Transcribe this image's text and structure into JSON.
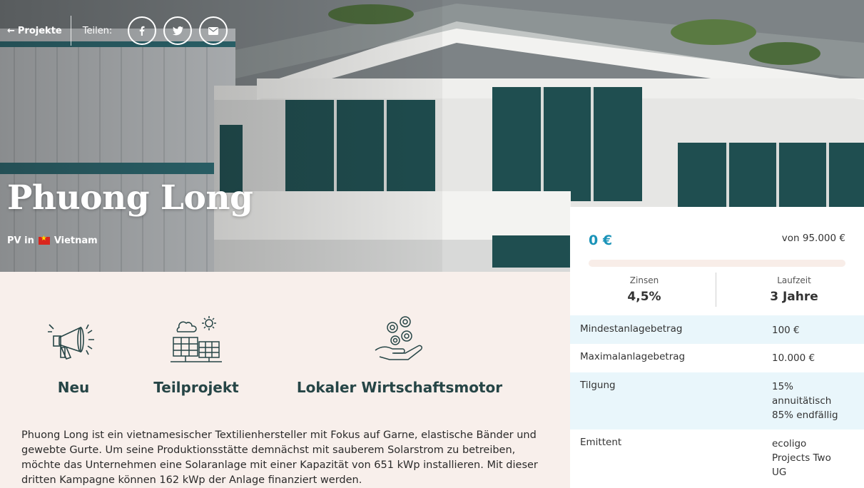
{
  "nav": {
    "back_label": "Projekte",
    "share_label": "Teilen:",
    "social": [
      "facebook-icon",
      "twitter-icon",
      "email-icon"
    ]
  },
  "hero": {
    "title": "Phuong Long",
    "technology": "PV in",
    "country": "Vietnam"
  },
  "features": [
    {
      "icon": "megaphone-icon",
      "label": "Neu"
    },
    {
      "icon": "solar-panel-icon",
      "label": "Teilprojekt"
    },
    {
      "icon": "hand-coins-icon",
      "label": "Lokaler Wirtschaftsmotor"
    }
  ],
  "description": "Phuong Long ist ein vietnamesischer Textilienhersteller mit Fokus auf Garne, elastische Bänder und gewebte Gurte. Um seine Produktionsstätte demnächst mit sauberem Solarstrom zu betreiben, möchte das Unternehmen eine Solaranlage mit einer Kapazität von 651 kWp installieren. Mit dieser dritten Kampagne können 162 kWp der Anlage finanziert werden.",
  "investment": {
    "amount": "0 €",
    "goal": "von 95.000 €",
    "progress_fraction": 0,
    "interest_label": "Zinsen",
    "interest_value": "4,5%",
    "term_label": "Laufzeit",
    "term_value": "3 Jahre",
    "rows": [
      {
        "key": "Mindestanlagebetrag",
        "value": "100 €"
      },
      {
        "key": "Maximalanlagebetrag",
        "value": "10.000 €"
      },
      {
        "key": "Tilgung",
        "value_lines": [
          "15%",
          "annuitätisch",
          "85% endfällig"
        ]
      },
      {
        "key": "Emittent",
        "value_lines": [
          "ecoligo",
          "Projects Two",
          "UG"
        ]
      }
    ]
  },
  "colors": {
    "accent": "#1a93b8",
    "dark_green": "#264546",
    "content_bg": "#f8efeb",
    "row_tint": "#e9f6fb"
  }
}
